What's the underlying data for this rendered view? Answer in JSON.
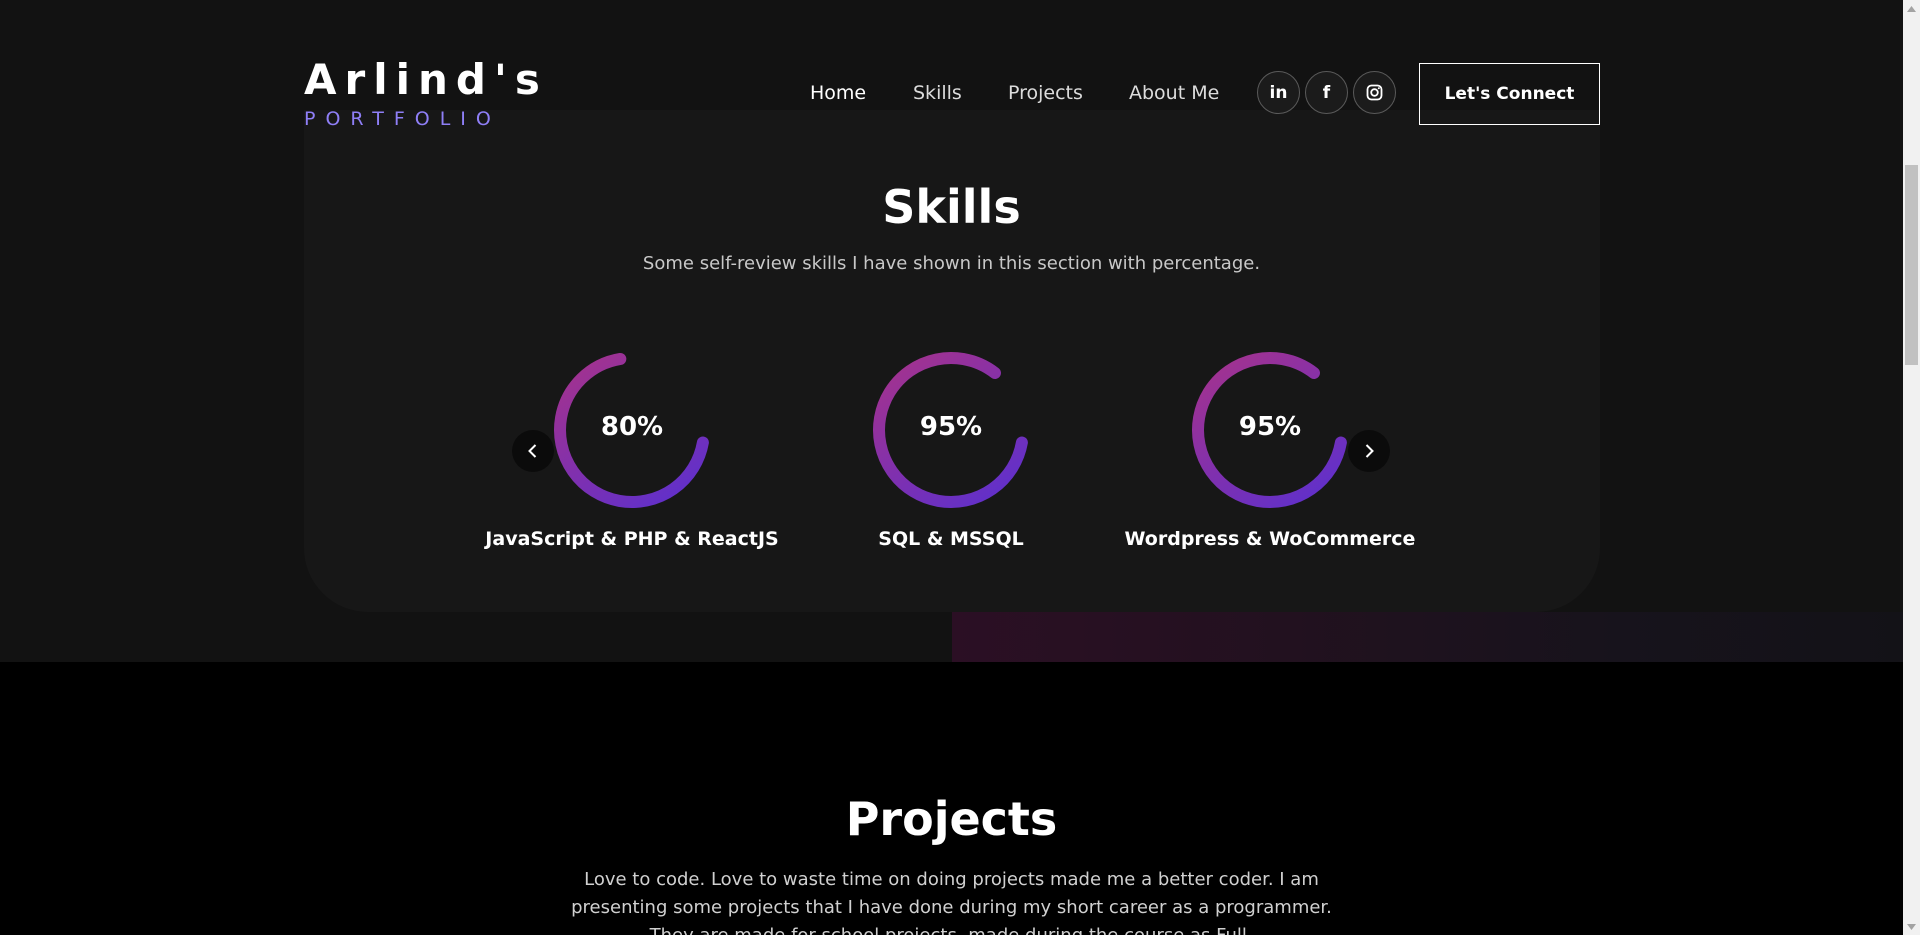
{
  "brand": {
    "name": "Arlind's",
    "subtitle": "PORTFOLIO"
  },
  "nav": {
    "links": [
      "Home",
      "Skills",
      "Projects",
      "About Me"
    ],
    "active": "Home",
    "social_icons": [
      "linkedin-icon",
      "facebook-icon",
      "instagram-icon"
    ],
    "social_glyphs": [
      "in",
      "f",
      ""
    ],
    "connect_label": "Let's Connect"
  },
  "skills": {
    "title": "Skills",
    "description": "Some self-review skills I have shown in this section with percentage.",
    "items": [
      {
        "value": "80%",
        "percent": 80,
        "label": "JavaScript & PHP & ReactJS"
      },
      {
        "value": "95%",
        "percent": 95,
        "label": "SQL & MSSQL"
      },
      {
        "value": "95%",
        "percent": 95,
        "label": "Wordpress & WoCommerce"
      }
    ],
    "prev_icon": "chevron-left-icon",
    "next_icon": "chevron-right-icon"
  },
  "projects": {
    "title": "Projects",
    "description": "Love to code. Love to waste time on doing projects made me a better coder. I am presenting some projects that I have done during my short career as a programmer. They are made for school projects, made during the course as Full-"
  },
  "colors": {
    "accent": "#8f7ff7",
    "ring_start": "#a8328a",
    "ring_end": "#5a2fd0",
    "background": "#121212",
    "card": "#171717"
  }
}
